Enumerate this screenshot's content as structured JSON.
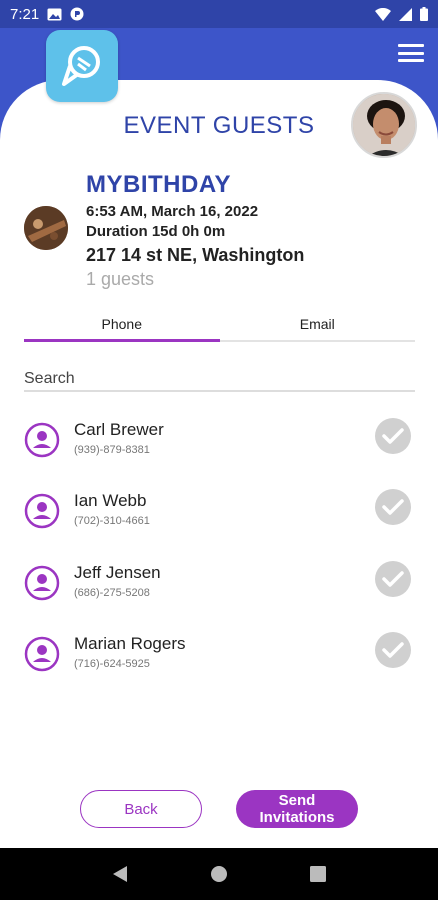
{
  "status_bar": {
    "time": "7:21",
    "left_icons": [
      "image-icon",
      "cast-icon"
    ],
    "right_icons": [
      "wifi-icon",
      "signal-icon",
      "battery-icon"
    ]
  },
  "header": {
    "title": "EVENT GUESTS",
    "menu_icon": "hamburger-menu-icon",
    "logo_icon": "app-logo-icon"
  },
  "event": {
    "name": "MYBITHDAY",
    "date": "6:53 AM, March 16, 2022",
    "duration": "Duration 15d 0h 0m",
    "address": "217 14 st NE, Washington",
    "guests": "1 guests"
  },
  "tabs": [
    {
      "label": "Phone",
      "active": true
    },
    {
      "label": "Email",
      "active": false
    }
  ],
  "search": {
    "placeholder": "Search",
    "value": ""
  },
  "contacts": [
    {
      "name": "Carl Brewer",
      "phone": "(939)-879-8381"
    },
    {
      "name": "Ian Webb",
      "phone": "(702)-310-4661"
    },
    {
      "name": "Jeff Jensen",
      "phone": "(686)-275-5208"
    },
    {
      "name": "Marian Rogers",
      "phone": "(716)-624-5925"
    }
  ],
  "buttons": {
    "back": "Back",
    "send_line1": "Send",
    "send_line2": "Invitations"
  },
  "colors": {
    "primary_blue": "#2f44a8",
    "header_blue": "#3d55c9",
    "accent_purple": "#9b35c2",
    "logo_cyan": "#5ec1ea",
    "check_grey": "#d0d0d0"
  },
  "nav_bar": [
    "back-icon",
    "home-icon",
    "recents-icon"
  ]
}
